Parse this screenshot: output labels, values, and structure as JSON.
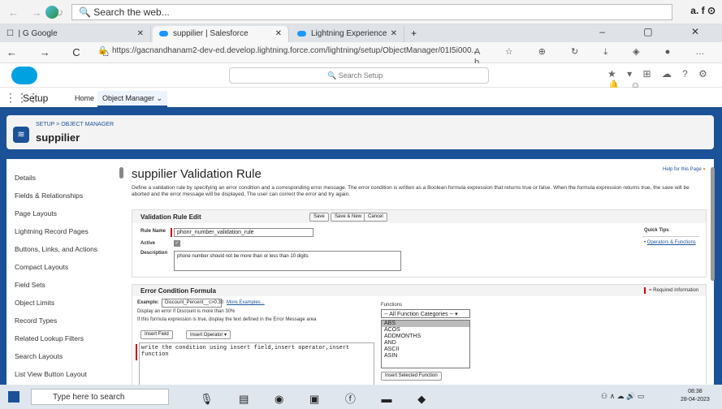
{
  "browser": {
    "search_placeholder": "Search the web...",
    "tabs": [
      {
        "label": "Google"
      },
      {
        "label": "suppilier | Salesforce"
      },
      {
        "label": "Lightning Experience"
      }
    ],
    "url": "https://gacnandhanam2-dev-ed.develop.lightning.force.com/lightning/setup/ObjectManager/01I5i000..."
  },
  "sf": {
    "search_placeholder": "Search Setup",
    "setup_title": "Setup",
    "home": "Home",
    "object_manager": "Object Manager",
    "breadcrumb": "SETUP > OBJECT MANAGER",
    "object_name": "suppilier"
  },
  "sidebar": {
    "items": [
      {
        "label": "Details"
      },
      {
        "label": "Fields & Relationships"
      },
      {
        "label": "Page Layouts"
      },
      {
        "label": "Lightning Record Pages"
      },
      {
        "label": "Buttons, Links, and Actions"
      },
      {
        "label": "Compact Layouts"
      },
      {
        "label": "Field Sets"
      },
      {
        "label": "Object Limits"
      },
      {
        "label": "Record Types"
      },
      {
        "label": "Related Lookup Filters"
      },
      {
        "label": "Search Layouts"
      },
      {
        "label": "List View Button Layout"
      }
    ]
  },
  "main": {
    "title": "suppilier Validation Rule",
    "help": "Help for this Page",
    "description": "Define a validation rule by specifying an error condition and a corresponding error message. The error condition is written as a Boolean formula expression that returns true or false. When the formula expression returns true, the save will be aborted and the error message will be displayed. The user can correct the error and try again.",
    "edit_header": "Validation Rule Edit",
    "save": "Save",
    "save_new": "Save & New",
    "cancel": "Cancel",
    "rule_name_label": "Rule Name",
    "rule_name_value": "phonr_number_validation_rule",
    "active_label": "Active",
    "description_label": "Description",
    "description_value": "phone number should not be more than or less than 10 digits",
    "quick_tips": "Quick Tips",
    "operators_link": "Operators & Functions",
    "error_header": "Error Condition Formula",
    "required_info": "= Required Information",
    "example_label": "Example:",
    "example_value": "Discount_Percent__c>0.30",
    "more_examples": "More Examples...",
    "example_desc": "Display an error if Discount is more than 30%",
    "if_true": "If this formula expression is true, display the text defined in the Error Message area",
    "insert_field": "Insert Field",
    "insert_operator": "Insert Operator",
    "formula_line1": "write the condition using insert field,insert operator,insert",
    "formula_line2": "function",
    "functions_label": "Functions",
    "function_categories": "-- All Function Categories --",
    "functions": [
      "ABS",
      "ACOS",
      "ADDMONTHS",
      "AND",
      "ASCII",
      "ASIN"
    ],
    "insert_selected": "Insert Selected Function"
  },
  "taskbar": {
    "search": "Type here to search",
    "time": "08:38",
    "date": "28-04-2023"
  }
}
